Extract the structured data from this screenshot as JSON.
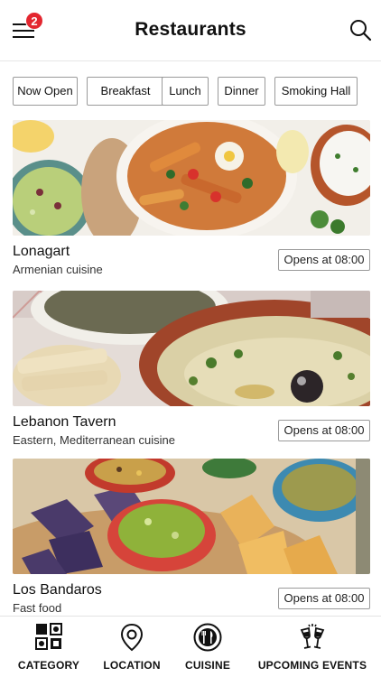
{
  "header": {
    "title": "Restaurants",
    "notification_count": "2"
  },
  "filters": [
    "Now Open",
    "Breakfast",
    "Lunch",
    "Dinner",
    "Smoking Hall"
  ],
  "restaurants": [
    {
      "name": "Lonagart",
      "cuisine": "Armenian cuisine",
      "opens": "Opens at 08:00"
    },
    {
      "name": "Lebanon Tavern",
      "cuisine": "Eastern, Mediterranean cuisine",
      "opens": "Opens at 08:00"
    },
    {
      "name": "Los Bandaros",
      "cuisine": "Fast food",
      "opens": "Opens at 08:00"
    }
  ],
  "bottom_nav": {
    "category": "CATEGORY",
    "location": "LOCATION",
    "cuisine": "CUISINE",
    "events": "UPCOMING EVENTS"
  },
  "icons": [
    "menu-icon",
    "search-icon",
    "category-icon",
    "location-pin-icon",
    "plate-cutlery-icon",
    "cheers-glasses-icon"
  ],
  "colors": {
    "badge": "#e3262f",
    "text": "#111111",
    "border": "#9a9a9a"
  }
}
